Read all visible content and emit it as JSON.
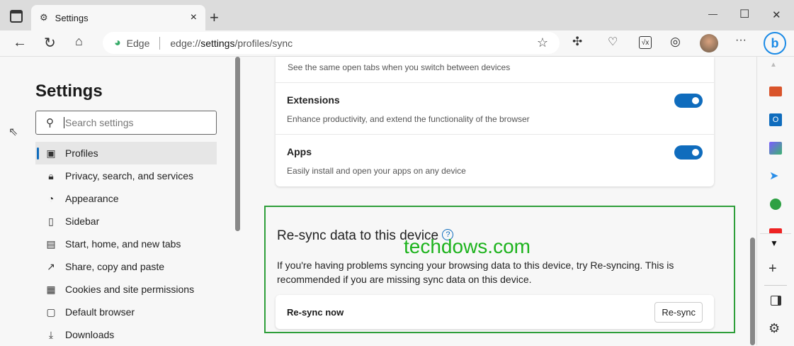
{
  "tab": {
    "title": "Settings",
    "close": "×",
    "new": "+"
  },
  "window": {
    "minimize": "—",
    "maximize": "☐",
    "close": "✕"
  },
  "address": {
    "brand": "Edge",
    "prefix": "edge://",
    "bold": "settings",
    "suffix": "/profiles/sync"
  },
  "toolbar": {
    "more": "···"
  },
  "settings": {
    "title": "Settings",
    "search_placeholder": "Search settings",
    "nav": [
      {
        "label": "Profiles",
        "icon": "▣"
      },
      {
        "label": "Privacy, search, and services",
        "icon": "🔒︎"
      },
      {
        "label": "Appearance",
        "icon": "◔"
      },
      {
        "label": "Sidebar",
        "icon": "▯"
      },
      {
        "label": "Start, home, and new tabs",
        "icon": "▤"
      },
      {
        "label": "Share, copy and paste",
        "icon": "↗"
      },
      {
        "label": "Cookies and site permissions",
        "icon": "▦"
      },
      {
        "label": "Default browser",
        "icon": "▢"
      },
      {
        "label": "Downloads",
        "icon": "⤓"
      }
    ]
  },
  "sync": {
    "tabs_desc": "See the same open tabs when you switch between devices",
    "items": [
      {
        "title": "Extensions",
        "desc": "Enhance productivity, and extend the functionality of the browser",
        "on": true
      },
      {
        "title": "Apps",
        "desc": "Easily install and open your apps on any device",
        "on": true
      }
    ]
  },
  "resync": {
    "title": "Re-sync data to this device",
    "help": "?",
    "desc": "If you're having problems syncing your browsing data to this device, try Re-syncing. This is recommended if you are missing sync data on this device.",
    "row_label": "Re-sync now",
    "button": "Re-sync"
  },
  "watermark": "techdows.com",
  "colors": {
    "accent": "#0f6cbd",
    "highlight": "#2e9e3a"
  }
}
